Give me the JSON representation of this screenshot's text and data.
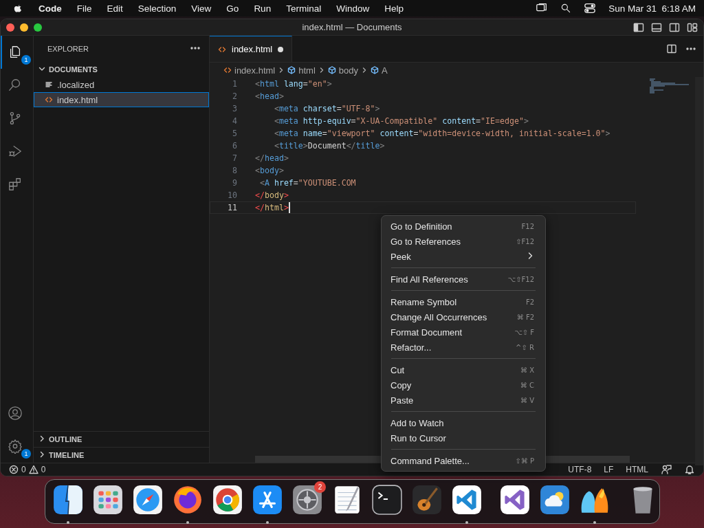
{
  "menubar": {
    "app": "Code",
    "menus": [
      "File",
      "Edit",
      "Selection",
      "View",
      "Go",
      "Run",
      "Terminal",
      "Window",
      "Help"
    ],
    "clock": "Sun Mar 31  6:18 AM"
  },
  "window": {
    "title": "index.html — Documents"
  },
  "activity_bar": {
    "items": [
      {
        "kind": "files",
        "selected": true,
        "badge": "1"
      },
      {
        "kind": "search",
        "selected": false
      },
      {
        "kind": "source-control",
        "selected": false
      },
      {
        "kind": "run-debug",
        "selected": false
      },
      {
        "kind": "extensions",
        "selected": false
      }
    ],
    "bottom": [
      {
        "kind": "account"
      },
      {
        "kind": "settings",
        "badge": "1"
      }
    ]
  },
  "sidebar": {
    "title": "EXPLORER",
    "sections": [
      {
        "title": "DOCUMENTS",
        "expanded": true,
        "children": [
          {
            "name": ".localized",
            "kind": "text",
            "selected": false
          },
          {
            "name": "index.html",
            "kind": "html",
            "selected": true
          }
        ]
      },
      {
        "title": "OUTLINE",
        "expanded": false
      },
      {
        "title": "TIMELINE",
        "expanded": false
      }
    ]
  },
  "tabs": [
    {
      "label": "index.html",
      "selected": true,
      "dirty": true
    }
  ],
  "breadcrumbs": [
    {
      "label": "index.html",
      "kind": "file"
    },
    {
      "label": "html",
      "kind": "element"
    },
    {
      "label": "body",
      "kind": "element"
    },
    {
      "label": "A",
      "kind": "element"
    }
  ],
  "editor": {
    "lines": [
      {
        "number": "1",
        "active": false,
        "tokens": [
          {
            "kind": "bracket",
            "text": "<"
          },
          {
            "kind": "tag",
            "text": "html"
          },
          {
            "kind": "attr",
            "text": " lang"
          },
          {
            "kind": "text",
            "text": "="
          },
          {
            "kind": "str",
            "text": "\"en\""
          },
          {
            "kind": "bracket",
            "text": ">"
          }
        ]
      },
      {
        "number": "2",
        "active": false,
        "tokens": [
          {
            "kind": "bracket",
            "text": "<"
          },
          {
            "kind": "tag",
            "text": "head"
          },
          {
            "kind": "bracket",
            "text": ">"
          }
        ]
      },
      {
        "number": "3",
        "active": false,
        "tokens": [
          {
            "kind": "bracket",
            "text": "    <"
          },
          {
            "kind": "tag",
            "text": "meta"
          },
          {
            "kind": "attr",
            "text": " charset"
          },
          {
            "kind": "text",
            "text": "="
          },
          {
            "kind": "str",
            "text": "\"UTF-8\""
          },
          {
            "kind": "bracket",
            "text": ">"
          }
        ]
      },
      {
        "number": "4",
        "active": false,
        "tokens": [
          {
            "kind": "bracket",
            "text": "    <"
          },
          {
            "kind": "tag",
            "text": "meta"
          },
          {
            "kind": "attr",
            "text": " http-equiv"
          },
          {
            "kind": "text",
            "text": "="
          },
          {
            "kind": "str",
            "text": "\"X-UA-Compatible\""
          },
          {
            "kind": "attr",
            "text": " content"
          },
          {
            "kind": "text",
            "text": "="
          },
          {
            "kind": "str",
            "text": "\"IE=edge\""
          },
          {
            "kind": "bracket",
            "text": ">"
          }
        ]
      },
      {
        "number": "5",
        "active": false,
        "tokens": [
          {
            "kind": "bracket",
            "text": "    <"
          },
          {
            "kind": "tag",
            "text": "meta"
          },
          {
            "kind": "attr",
            "text": " name"
          },
          {
            "kind": "text",
            "text": "="
          },
          {
            "kind": "str",
            "text": "\"viewport\""
          },
          {
            "kind": "attr",
            "text": " content"
          },
          {
            "kind": "text",
            "text": "="
          },
          {
            "kind": "str",
            "text": "\"width=device-width, initial-scale=1.0\""
          },
          {
            "kind": "bracket",
            "text": ">"
          }
        ]
      },
      {
        "number": "6",
        "active": false,
        "tokens": [
          {
            "kind": "bracket",
            "text": "    <"
          },
          {
            "kind": "tag",
            "text": "title"
          },
          {
            "kind": "bracket",
            "text": ">"
          },
          {
            "kind": "text",
            "text": "Document"
          },
          {
            "kind": "bracket",
            "text": "</"
          },
          {
            "kind": "tag",
            "text": "title"
          },
          {
            "kind": "bracket",
            "text": ">"
          }
        ]
      },
      {
        "number": "7",
        "active": false,
        "tokens": [
          {
            "kind": "bracket",
            "text": "</"
          },
          {
            "kind": "tag",
            "text": "head"
          },
          {
            "kind": "bracket",
            "text": ">"
          }
        ]
      },
      {
        "number": "8",
        "active": false,
        "tokens": [
          {
            "kind": "bracket",
            "text": "<"
          },
          {
            "kind": "tag",
            "text": "body"
          },
          {
            "kind": "bracket",
            "text": ">"
          }
        ]
      },
      {
        "number": "9",
        "active": false,
        "tokens": [
          {
            "kind": "bracket",
            "text": " <"
          },
          {
            "kind": "tag",
            "text": "A"
          },
          {
            "kind": "attr",
            "text": " href"
          },
          {
            "kind": "text",
            "text": "="
          },
          {
            "kind": "str",
            "text": "\"YOUTUBE.COM"
          }
        ]
      },
      {
        "number": "10",
        "active": false,
        "tokens": [
          {
            "kind": "error",
            "text": "</"
          },
          {
            "kind": "errtag",
            "text": "body"
          },
          {
            "kind": "error",
            "text": ">"
          }
        ]
      },
      {
        "number": "11",
        "active": true,
        "tokens": [
          {
            "kind": "error",
            "text": "</"
          },
          {
            "kind": "errtag",
            "text": "html"
          },
          {
            "kind": "error",
            "text": ">"
          }
        ]
      }
    ]
  },
  "context_menu": {
    "groups": [
      {
        "items": [
          {
            "label": "Go to Definition",
            "shortcut": "F12",
            "kind": "command"
          },
          {
            "label": "Go to References",
            "shortcut": "⇧F12",
            "kind": "command"
          },
          {
            "label": "Peek",
            "kind": "submenu"
          }
        ]
      },
      {
        "items": [
          {
            "label": "Find All References",
            "shortcut": "⌥⇧F12",
            "kind": "command"
          }
        ]
      },
      {
        "items": [
          {
            "label": "Rename Symbol",
            "shortcut": "F2",
            "kind": "command"
          },
          {
            "label": "Change All Occurrences",
            "shortcut": "⌘ F2",
            "kind": "command"
          },
          {
            "label": "Format Document",
            "shortcut": "⌥⇧ F",
            "kind": "command"
          },
          {
            "label": "Refactor...",
            "shortcut": "^⇧ R",
            "kind": "command"
          }
        ]
      },
      {
        "items": [
          {
            "label": "Cut",
            "shortcut": "⌘ X",
            "kind": "command"
          },
          {
            "label": "Copy",
            "shortcut": "⌘ C",
            "kind": "command"
          },
          {
            "label": "Paste",
            "shortcut": "⌘ V",
            "kind": "command"
          }
        ]
      },
      {
        "items": [
          {
            "label": "Add to Watch",
            "kind": "command"
          },
          {
            "label": "Run to Cursor",
            "kind": "command"
          }
        ]
      },
      {
        "items": [
          {
            "label": "Command Palette...",
            "shortcut": "⇧⌘ P",
            "kind": "command"
          }
        ]
      }
    ]
  },
  "status_bar": {
    "errors": "0",
    "warnings": "0",
    "items": [
      "UTF-8",
      "LF",
      "HTML"
    ]
  },
  "dock": {
    "groups": [
      {
        "items": [
          {
            "kind": "finder",
            "running": true
          },
          {
            "kind": "launchpad",
            "running": false
          },
          {
            "kind": "safari",
            "running": false
          },
          {
            "kind": "firefox",
            "running": true
          },
          {
            "kind": "chrome",
            "running": false
          },
          {
            "kind": "appstore",
            "running": true
          },
          {
            "kind": "settings",
            "running": false,
            "badge": "2"
          },
          {
            "kind": "textedit",
            "running": false
          },
          {
            "kind": "terminal",
            "running": false
          },
          {
            "kind": "garageband",
            "running": false
          },
          {
            "kind": "vscode",
            "running": true
          }
        ]
      },
      {
        "items": [
          {
            "kind": "visualstudio",
            "running": false
          },
          {
            "kind": "weather",
            "running": false
          },
          {
            "kind": "mascots",
            "running": true
          }
        ]
      },
      {
        "items": [
          {
            "kind": "trash",
            "running": false
          }
        ]
      }
    ]
  }
}
